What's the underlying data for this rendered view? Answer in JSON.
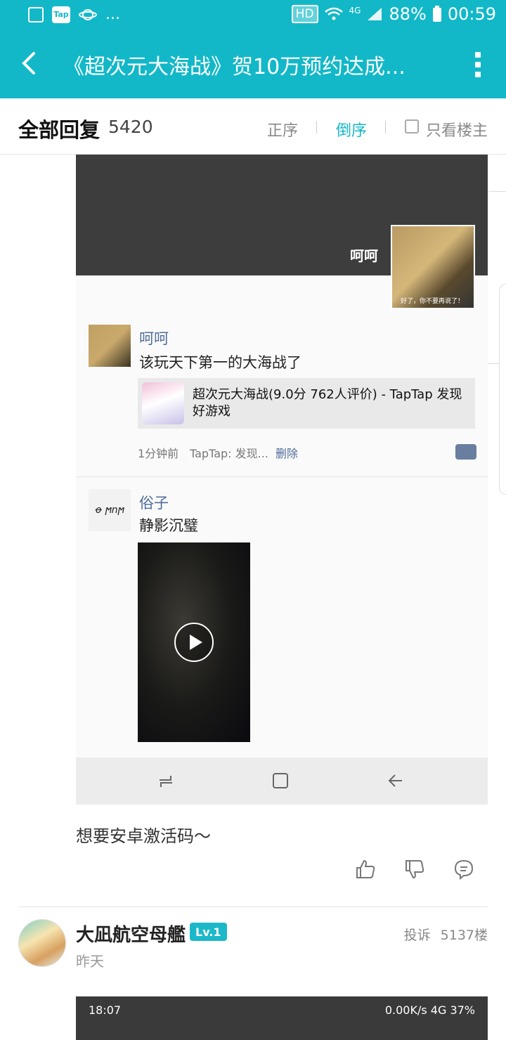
{
  "status_bar": {
    "more_indicator": "...",
    "hd_badge": "HD",
    "network": "4G",
    "battery": "88%",
    "time": "00:59"
  },
  "header": {
    "title": "《超次元大海战》贺10万预约达成...",
    "back_icon": "chevron-left-icon",
    "more_icon": "vertical-dots-icon"
  },
  "replies_bar": {
    "title": "全部回复",
    "count": "5420",
    "sort_asc": "正序",
    "sort_desc": "倒序",
    "only_op": "只看楼主",
    "active_color": "#12b8c8"
  },
  "screenshot_1": {
    "overlay_text": "呵呵",
    "sticker_caption": "好了，你不要再说了！",
    "comment_1": {
      "user": "呵呵",
      "text": "该玩天下第一的大海战了",
      "link_card_text": "超次元大海战(9.0分 762人评价) - TapTap 发现好游戏",
      "time": "1分钟前",
      "source": "TapTap: 发现...",
      "delete": "删除"
    },
    "comment_2": {
      "user": "俗子",
      "text": "静影沉璧"
    }
  },
  "post": {
    "text": "想要安卓激活码～",
    "like_icon": "thumbs-up-icon",
    "dislike_icon": "thumbs-down-icon",
    "reply_icon": "comment-icon"
  },
  "next_post": {
    "username": "大凪航空母艦",
    "level": "Lv.1",
    "report": "投诉",
    "floor": "5137楼",
    "time": "昨天",
    "embedded_status_left": "18:07",
    "embedded_status_right": "0.00K/s 4G 37%"
  }
}
